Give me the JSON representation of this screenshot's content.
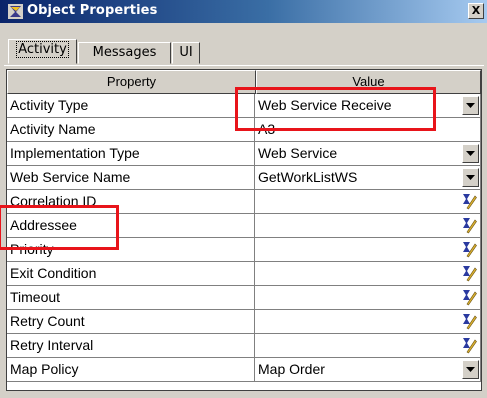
{
  "window": {
    "title": "Object Properties",
    "close_label": "X"
  },
  "tabs": [
    {
      "label": "Activity",
      "active": true
    },
    {
      "label": "Messages",
      "active": false
    },
    {
      "label": "UI",
      "active": false
    }
  ],
  "grid": {
    "columns": [
      "Property",
      "Value"
    ],
    "rows": [
      {
        "property": "Activity Type",
        "value": "Web Service Receive",
        "control": "dropdown"
      },
      {
        "property": "Activity Name",
        "value": "A3",
        "control": "none"
      },
      {
        "property": "Implementation Type",
        "value": "Web Service",
        "control": "dropdown"
      },
      {
        "property": "Web Service Name",
        "value": "GetWorkListWS",
        "control": "dropdown"
      },
      {
        "property": "Correlation ID",
        "value": "",
        "control": "edit"
      },
      {
        "property": "Addressee",
        "value": "",
        "control": "edit"
      },
      {
        "property": "Priority",
        "value": "",
        "control": "edit"
      },
      {
        "property": "Exit Condition",
        "value": "",
        "control": "edit"
      },
      {
        "property": "Timeout",
        "value": "",
        "control": "edit"
      },
      {
        "property": "Retry Count",
        "value": "",
        "control": "edit"
      },
      {
        "property": "Retry Interval",
        "value": "",
        "control": "edit"
      },
      {
        "property": "Map Policy",
        "value": "Map Order",
        "control": "dropdown"
      }
    ]
  },
  "colors": {
    "highlight": "#e8141a",
    "title_bar": "#0a246a",
    "panel": "#d4d0c8"
  }
}
